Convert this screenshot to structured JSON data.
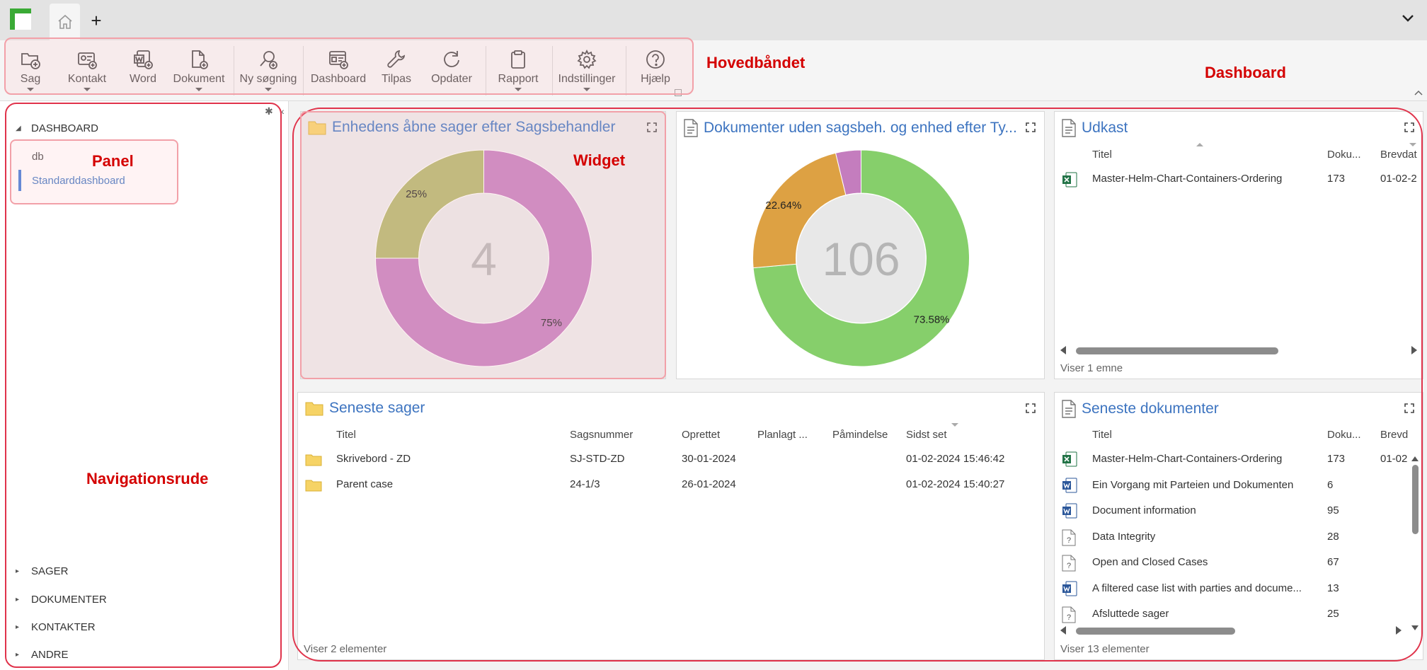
{
  "tabs": {
    "home_tab": "home",
    "add_tab": "+"
  },
  "ribbon": {
    "buttons": [
      {
        "label": "Sag",
        "icon": "folder-add-icon",
        "dropdown": true
      },
      {
        "label": "Kontakt",
        "icon": "contact-card-icon",
        "dropdown": true
      },
      {
        "label": "Word",
        "icon": "word-doc-icon",
        "dropdown": false
      },
      {
        "label": "Dokument",
        "icon": "document-add-icon",
        "dropdown": true
      },
      {
        "label": "Ny søgning",
        "icon": "search-add-icon",
        "dropdown": true
      },
      {
        "label": "Dashboard",
        "icon": "dashboard-add-icon",
        "dropdown": false
      },
      {
        "label": "Tilpas",
        "icon": "wrench-icon",
        "dropdown": false
      },
      {
        "label": "Opdater",
        "icon": "refresh-icon",
        "dropdown": false
      },
      {
        "label": "Rapport",
        "icon": "clipboard-icon",
        "dropdown": true
      },
      {
        "label": "Indstillinger",
        "icon": "gear-icon",
        "dropdown": true
      },
      {
        "label": "Hjælp",
        "icon": "help-icon",
        "dropdown": false
      }
    ]
  },
  "annotations": {
    "ribbon": "Hovedbåndet",
    "dashboard": "Dashboard",
    "panel": "Panel",
    "widget": "Widget",
    "navigation": "Navigationsrude"
  },
  "nav": {
    "dashboard_header": "DASHBOARD",
    "panel_items": [
      "db",
      "Standarddashboard"
    ],
    "sections": [
      "SAGER",
      "DOKUMENTER",
      "KONTAKTER",
      "ANDRE"
    ]
  },
  "colors": {
    "accent": "#3d74c0",
    "annotation": "#d40000",
    "pie_green": "#86cf6b",
    "pie_orange": "#dda143",
    "pie_pink": "#c47dbe",
    "pie_olive": "#b1b66a"
  },
  "widgets": {
    "w1": {
      "title": "Enhedens åbne sager efter Sagsbehandler",
      "center": "4"
    },
    "w2": {
      "title": "Dokumenter uden sagsbeh. og enhed efter Ty...",
      "center": "106"
    },
    "w3": {
      "title": "Udkast",
      "columns": [
        "Titel",
        "Doku...",
        "Brevdat"
      ],
      "rows": [
        {
          "icon": "excel-icon",
          "title": "Master-Helm-Chart-Containers-Ordering",
          "docs": "173",
          "date": "01-02-2"
        }
      ],
      "footer": "Viser 1 emne"
    },
    "w4": {
      "title": "Seneste sager",
      "columns": [
        "Titel",
        "Sagsnummer",
        "Oprettet",
        "Planlagt ...",
        "Påmindelse",
        "Sidst set"
      ],
      "rows": [
        {
          "title": "Skrivebord - ZD",
          "number": "SJ-STD-ZD",
          "created": "30-01-2024",
          "planned": "",
          "reminder": "",
          "last_seen": "01-02-2024 15:46:42"
        },
        {
          "title": "Parent case",
          "number": "24-1/3",
          "created": "26-01-2024",
          "planned": "",
          "reminder": "",
          "last_seen": "01-02-2024 15:40:27"
        }
      ],
      "footer": "Viser 2 elementer"
    },
    "w5": {
      "title": "Seneste dokumenter",
      "columns": [
        "Titel",
        "Doku...",
        "Brevd"
      ],
      "rows": [
        {
          "icon": "excel-icon",
          "title": "Master-Helm-Chart-Containers-Ordering",
          "docs": "173",
          "date": "01-02"
        },
        {
          "icon": "word-icon",
          "title": "Ein Vorgang mit Parteien und Dokumenten",
          "docs": "6",
          "date": ""
        },
        {
          "icon": "word-icon",
          "title": "Document information",
          "docs": "95",
          "date": ""
        },
        {
          "icon": "unknown-file-icon",
          "title": "Data Integrity",
          "docs": "28",
          "date": ""
        },
        {
          "icon": "unknown-file-icon",
          "title": "Open and Closed Cases",
          "docs": "67",
          "date": ""
        },
        {
          "icon": "word-icon",
          "title": "A filtered case list with parties and docume...",
          "docs": "13",
          "date": ""
        },
        {
          "icon": "unknown-file-icon",
          "title": "Afsluttede sager",
          "docs": "25",
          "date": ""
        }
      ],
      "footer": "Viser 13 elementer"
    }
  },
  "chart_data": [
    {
      "type": "pie",
      "title": "Enhedens åbne sager efter Sagsbehandler",
      "center_label": "4",
      "slices": [
        {
          "value": 75,
          "label": "75%",
          "color": "#c47dbe"
        },
        {
          "value": 25,
          "label": "25%",
          "color": "#b1b66a"
        }
      ]
    },
    {
      "type": "pie",
      "title": "Dokumenter uden sagsbeh. og enhed efter Ty...",
      "center_label": "106",
      "slices": [
        {
          "value": 73.58,
          "label": "73.58%",
          "color": "#86cf6b"
        },
        {
          "value": 22.64,
          "label": "22.64%",
          "color": "#dda143"
        },
        {
          "value": 3.78,
          "label": "",
          "color": "#c47dbe"
        }
      ]
    }
  ]
}
